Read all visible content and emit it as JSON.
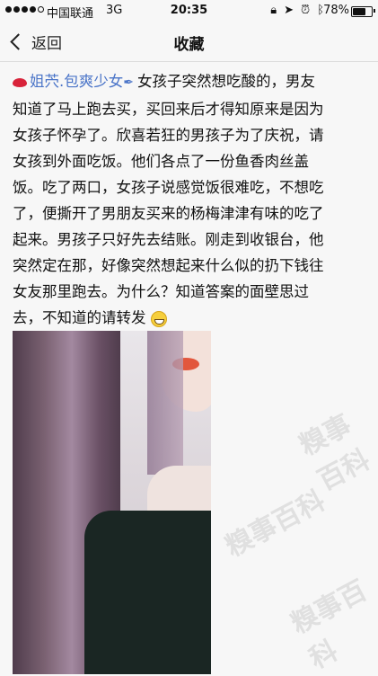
{
  "status_bar": {
    "carrier": "中国联通",
    "network": "3G",
    "time": "20:35",
    "battery_percent": "78%",
    "battery_level": 0.78
  },
  "nav": {
    "back_label": "返回",
    "title": "收藏"
  },
  "post": {
    "username": "姐茓.包爽少女",
    "text_lines": [
      "女孩子突然想吃酸的，男友",
      "知道了马上跑去买，买回来后才得知原来是因为",
      "女孩子怀孕了。欣喜若狂的男孩子为了庆祝，请",
      "女孩到外面吃饭。他们各点了一份鱼香肉丝盖",
      "饭。吃了两口，女孩子说感觉饭很难吃，不想吃",
      "了，便撕开了男朋友买来的杨梅津津有味的吃了",
      "起来。男孩子只好先去结账。刚走到收银台，他",
      "突然定在那，好像突然想起来什么似的扔下钱往",
      "女友那里跑去。为什么？知道答案的面壁思过",
      "去，不知道的请转发"
    ]
  },
  "watermark_text": "糗事百科",
  "colors": {
    "username": "#4a74c8",
    "lips_icon": "#d8233a",
    "background": "#f7f7f7"
  },
  "icons": {
    "back": "chevron-left-icon",
    "lips": "kiss-mark-icon",
    "pen": "pen-icon",
    "emoji": "grinning-face-icon",
    "status": [
      "lock-icon",
      "location-arrow-icon",
      "alarm-icon",
      "bluetooth-icon"
    ]
  }
}
